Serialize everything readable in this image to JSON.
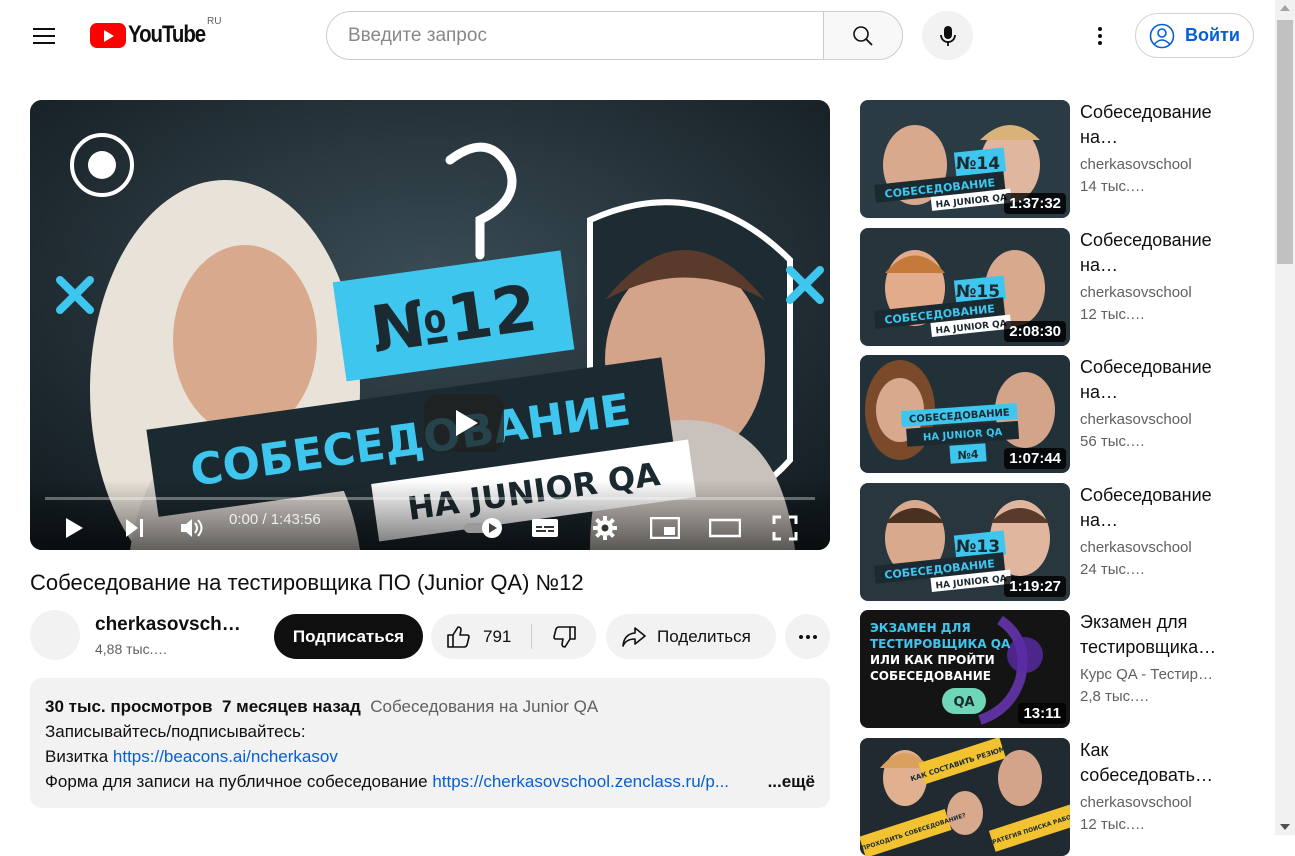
{
  "header": {
    "logo_text": "YouTube",
    "region": "RU",
    "search_placeholder": "Введите запрос",
    "signin_label": "Войти"
  },
  "player": {
    "time_current": "0:00",
    "time_total": "1:43:56",
    "time_display": "0:00 / 1:43:56",
    "thumb_text_number": "№12",
    "thumb_text_line1": "СОБЕСЕДОВАНИЕ",
    "thumb_text_line2": "НА JUNIOR QA"
  },
  "video": {
    "title": "Собеседование на тестировщика ПО (Junior QA) №12",
    "channel_name": "cherkasovsch…",
    "channel_subs": "4,88 тыс.…",
    "subscribe_label": "Подписаться",
    "like_count": "791",
    "share_label": "Поделиться"
  },
  "description": {
    "views": "30 тыс. просмотров",
    "published": "7 месяцев назад",
    "playlist": "Собеседования на Junior QA",
    "line2": "Записывайтесь/подписывайтесь:",
    "line3_prefix": "Визитка ",
    "line3_link": "https://beacons.ai/ncherkasov",
    "line4_prefix": "Форма для записи на публичное собеседование ",
    "line4_link": "https://cherkasovschool.zenclass.ru/p...",
    "more_label": "...ещё"
  },
  "recommendations": [
    {
      "title": "Собеседование на…",
      "channel": "cherkasovschool",
      "views": "14 тыс.…",
      "duration": "1:37:32",
      "badge": "№14",
      "color_bg": "#2a3b44"
    },
    {
      "title": "Собеседование на…",
      "channel": "cherkasovschool",
      "views": "12 тыс.…",
      "duration": "2:08:30",
      "badge": "№15",
      "color_bg": "#26343c"
    },
    {
      "title": "Собеседование на…",
      "channel": "cherkasovschool",
      "views": "56 тыс.…",
      "duration": "1:07:44",
      "badge": "№4",
      "color_bg": "#223038"
    },
    {
      "title": "Собеседование на…",
      "channel": "cherkasovschool",
      "views": "24 тыс.…",
      "duration": "1:19:27",
      "badge": "№13",
      "color_bg": "#28363e"
    },
    {
      "title": "Экзамен для тестировщика…",
      "channel": "Курс QA - Тестир…",
      "views": "2,8 тыс.…",
      "duration": "13:11",
      "badge": "",
      "color_bg": "#1a1a1a"
    },
    {
      "title": "Как собеседовать…",
      "channel": "cherkasovschool",
      "views": "12 тыс.…",
      "duration": "",
      "badge": "",
      "color_bg": "#202a30"
    }
  ],
  "thumb_texts": {
    "interview": "СОБЕСЕДОВАНИЕ",
    "junior": "НА JUNIOR QA",
    "exam_lines": [
      "ЭКЗАМЕН ДЛЯ",
      "ТЕСТИРОВЩИКА QA",
      "ИЛИ КАК ПРОЙТИ",
      "СОБЕСЕДОВАНИЕ"
    ],
    "qa_badge": "QA",
    "how_interview": "КАК СОСТАВИТЬ РЕЗЮМЕ?",
    "how_pass": "КАК ПРОХОДИТЬ СОБЕСЕДОВАНИЕ?",
    "strategy": "СТРАТЕГИЯ ПОИСКА РАБОТЫ"
  },
  "colors": {
    "accent_blue": "#065fd4",
    "brand_red": "#ff0000",
    "thumb_cyan": "#3ec6ee"
  }
}
